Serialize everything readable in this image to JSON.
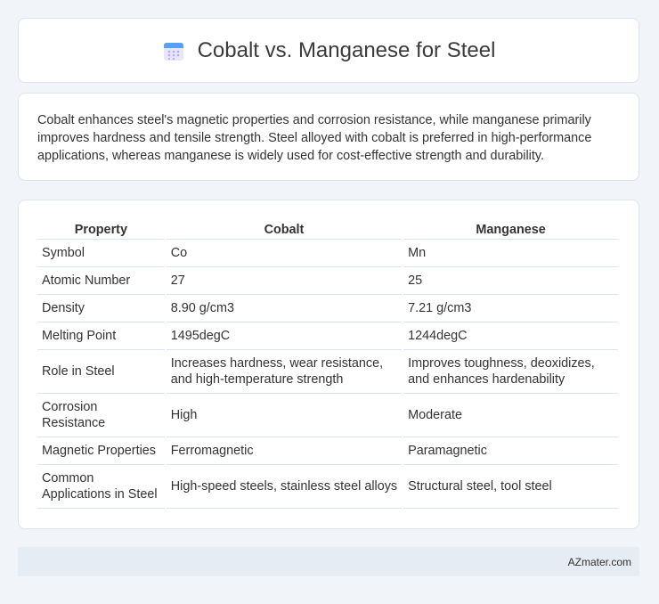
{
  "header": {
    "title": "Cobalt vs. Manganese for Steel",
    "icon": "calendar-icon"
  },
  "summary": {
    "text": "Cobalt enhances steel's magnetic properties and corrosion resistance, while manganese primarily improves hardness and tensile strength. Steel alloyed with cobalt is preferred in high-performance applications, whereas manganese is widely used for cost-effective strength and durability."
  },
  "table": {
    "headers": [
      "Property",
      "Cobalt",
      "Manganese"
    ],
    "rows": [
      [
        "Symbol",
        "Co",
        "Mn"
      ],
      [
        "Atomic Number",
        "27",
        "25"
      ],
      [
        "Density",
        "8.90 g/cm3",
        "7.21 g/cm3"
      ],
      [
        "Melting Point",
        "1495degC",
        "1244degC"
      ],
      [
        "Role in Steel",
        "Increases hardness, wear resistance, and high-temperature strength",
        "Improves toughness, deoxidizes, and enhances hardenability"
      ],
      [
        "Corrosion Resistance",
        "High",
        "Moderate"
      ],
      [
        "Magnetic Properties",
        "Ferromagnetic",
        "Paramagnetic"
      ],
      [
        "Common Applications in Steel",
        "High-speed steels, stainless steel alloys",
        "Structural steel, tool steel"
      ]
    ]
  },
  "footer": {
    "brand": "AZmater.com"
  },
  "colors": {
    "background": "#f1f4f8",
    "card": "#ffffff",
    "border": "#dde3ea",
    "footer_bg": "#e6ecf4"
  }
}
